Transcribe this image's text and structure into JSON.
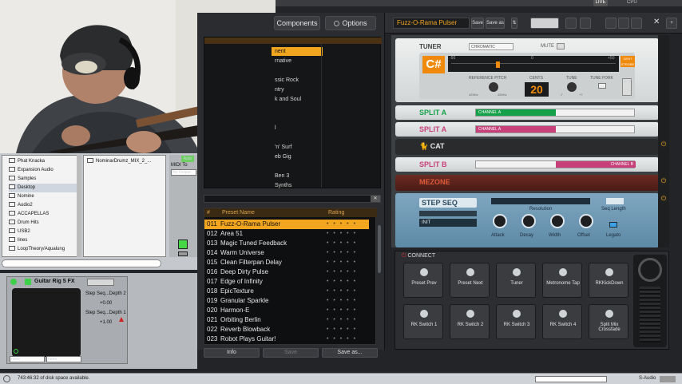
{
  "rig": {
    "components_label": "Components",
    "options_label": "Options",
    "preset_name": "Fuzz-O-Rama Pulser",
    "save_label": "Save",
    "save_as_label": "Save as",
    "live_label": "LIVE",
    "cpu_label": "CPU"
  },
  "banks": [
    "nent",
    "rnative",
    "",
    "ssic Rock",
    "ntry",
    "k and Soul",
    "",
    "",
    "l",
    "",
    "'n' Surf",
    "eb Gig",
    "",
    "Ben 3",
    "Synths"
  ],
  "preset_table": {
    "header_num": "#",
    "header_name": "Preset Name",
    "header_rating": "Rating",
    "rows": [
      {
        "num": "011",
        "name": "Fuzz-O-Rama Pulser",
        "rating": "• • • • •",
        "selected": true
      },
      {
        "num": "012",
        "name": "Area 51",
        "rating": "• • • • •"
      },
      {
        "num": "013",
        "name": "Magic Tuned Feedback",
        "rating": "• • • • •"
      },
      {
        "num": "014",
        "name": "Warm Universe",
        "rating": "• • • • •"
      },
      {
        "num": "015",
        "name": "Clean Filterpan Delay",
        "rating": "• • • • •"
      },
      {
        "num": "016",
        "name": "Deep Dirty Pulse",
        "rating": "• • • • •"
      },
      {
        "num": "017",
        "name": "Edge of Infinity",
        "rating": "• • • • •"
      },
      {
        "num": "018",
        "name": "EpicTexture",
        "rating": "• • • • •"
      },
      {
        "num": "019",
        "name": "Granular Sparkle",
        "rating": "• • • • •"
      },
      {
        "num": "020",
        "name": "Harmon-E",
        "rating": "• • • • •"
      },
      {
        "num": "021",
        "name": "Orbiting Berlin",
        "rating": "• • • • •"
      },
      {
        "num": "022",
        "name": "Reverb Blowback",
        "rating": "• • • • •"
      },
      {
        "num": "023",
        "name": "Robot Plays Guitar!",
        "rating": "• • • • •"
      }
    ],
    "info_label": "Info",
    "save_label": "Save",
    "save_as_label": "Save as..."
  },
  "tuner": {
    "title": "TUNER",
    "mode": "CHROMATIC",
    "mute_label": "MUTE",
    "note": "C#",
    "scale_left": "-50",
    "scale_mid": "0",
    "scale_right": "+50",
    "cent_label": "CENT STROBE",
    "ref_pitch_label": "REFERENCE PITCH",
    "ref_low": "425Hz",
    "ref_high": "455Hz",
    "cents_label": "CENTS",
    "cents_value": "20",
    "tune_label": "TUNE",
    "tune_low": "-7",
    "tune_high": "+7",
    "tune_fork_label": "TUNE FORK"
  },
  "modules": {
    "split_a1": "SPLIT A",
    "split_a2": "SPLIT A",
    "channel_a": "CHANNEL A",
    "cat": "CAT",
    "split_b": "SPLIT B",
    "channel_b": "CHANNEL B",
    "mezone": "MEZONE"
  },
  "step_seq": {
    "title": "STEP SEQ",
    "resolution_label": "Resolution",
    "seq_length_label": "Seq Length",
    "init_label": "INIT",
    "knobs": [
      "Attack",
      "Decay",
      "Width",
      "Offset"
    ],
    "legato_label": "Legato"
  },
  "connect": {
    "title": "CONNECT",
    "row1": [
      "Preset Prev",
      "Preset Next",
      "Tuner",
      "Metronome Tap",
      "RKKickDown"
    ],
    "row2": [
      "RK Switch 1",
      "RK Switch 2",
      "RK Switch 3",
      "RK Switch 4",
      "Split Mix Crossfade"
    ]
  },
  "host_browser": {
    "folders": [
      "Phat Knacka",
      "Expansion Audio",
      "Samples",
      "Desktop",
      "Nomine",
      "Audio2",
      "ACCAPELLAS",
      "Drum Hits",
      "USB2",
      "lines",
      "LoopTheory/Aqualung"
    ],
    "file": "NominarDrumz_MIX_2_...",
    "midi_to_label": "MIDI To",
    "no_output": "No Output",
    "auto_label": "Auto"
  },
  "fx_strip": {
    "title": "Guitar Rig 5 FX",
    "configure_label": "Configure",
    "param1": "Step Seq...Depth 2",
    "value1": "+0.00",
    "param2": "Step Seq...Depth 1",
    "value2": "+1.00",
    "none1": "none",
    "none2": "none"
  },
  "status": {
    "disk_text": "743:46:32 of disk space available.",
    "audio_label": "S-Audio"
  },
  "colors": {
    "accent_orange": "#f2a51f",
    "split_green": "#15a04a",
    "split_pink": "#c8407a",
    "tuner_orange": "#f08a0c"
  }
}
